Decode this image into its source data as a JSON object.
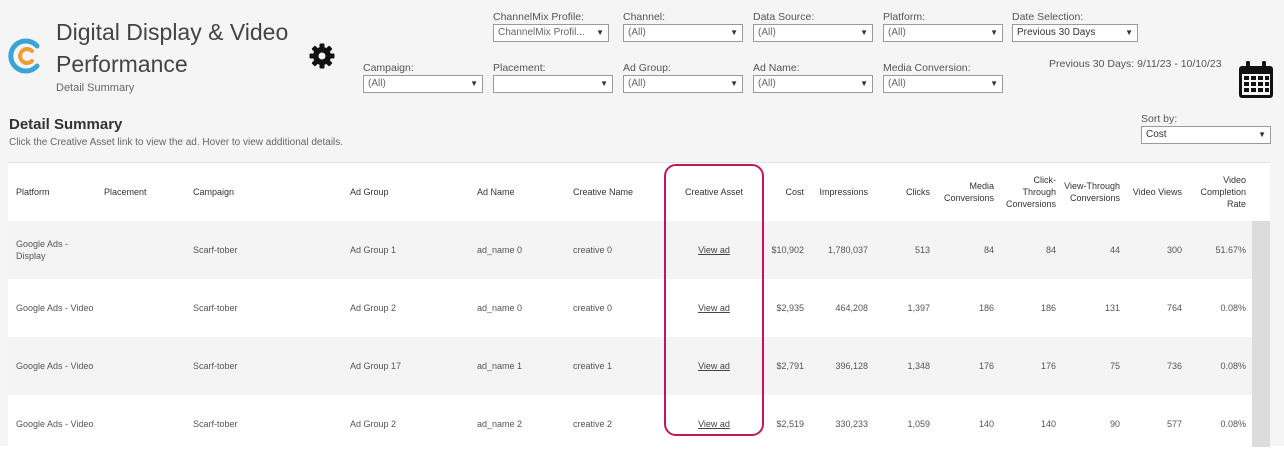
{
  "header": {
    "title": "Digital Display & Video Performance",
    "subtitle": "Detail Summary"
  },
  "filters": {
    "channelmix_profile": {
      "label": "ChannelMix Profile:",
      "value": "ChannelMix Profil..."
    },
    "channel": {
      "label": "Channel:",
      "value": "(All)"
    },
    "data_source": {
      "label": "Data Source:",
      "value": "(All)"
    },
    "platform": {
      "label": "Platform:",
      "value": "(All)"
    },
    "date_selection": {
      "label": "Date Selection:",
      "value": "Previous 30 Days"
    },
    "campaign": {
      "label": "Campaign:",
      "value": "(All)"
    },
    "placement": {
      "label": "Placement:",
      "value": ""
    },
    "ad_group": {
      "label": "Ad Group:",
      "value": "(All)"
    },
    "ad_name": {
      "label": "Ad Name:",
      "value": "(All)"
    },
    "media_conversion": {
      "label": "Media Conversion:",
      "value": "(All)"
    }
  },
  "date_range": "Previous 30 Days: 9/11/23 - 10/10/23",
  "detail": {
    "title": "Detail Summary",
    "subtitle": "Click the Creative Asset link to view the ad. Hover to view additional details.",
    "sort_by": {
      "label": "Sort by:",
      "value": "Cost"
    }
  },
  "table": {
    "headers": {
      "platform": "Platform",
      "placement": "Placement",
      "campaign": "Campaign",
      "ad_group": "Ad Group",
      "ad_name": "Ad Name",
      "creative_name": "Creative Name",
      "creative_asset": "Creative Asset",
      "cost": "Cost",
      "impressions": "Impressions",
      "clicks": "Clicks",
      "media_conversions": "Media Conversions",
      "click_through_conversions": "Click-Through Conversions",
      "view_through_conversions": "View-Through Conversions",
      "video_views": "Video Views",
      "video_completion_rate": "Video Completion Rate"
    },
    "rows": [
      {
        "platform": "Google Ads - Display",
        "placement": "",
        "campaign": "Scarf-tober",
        "ad_group": "Ad Group 1",
        "ad_name": "ad_name 0",
        "creative_name": "creative 0",
        "creative_asset": "View ad",
        "cost": "$10,902",
        "impressions": "1,780,037",
        "clicks": "513",
        "media_conversions": "84",
        "click_through_conversions": "84",
        "view_through_conversions": "44",
        "video_views": "300",
        "video_completion_rate": "51.67%"
      },
      {
        "platform": "Google Ads - Video",
        "placement": "",
        "campaign": "Scarf-tober",
        "ad_group": "Ad Group 2",
        "ad_name": "ad_name 0",
        "creative_name": "creative 0",
        "creative_asset": "View ad",
        "cost": "$2,935",
        "impressions": "464,208",
        "clicks": "1,397",
        "media_conversions": "186",
        "click_through_conversions": "186",
        "view_through_conversions": "131",
        "video_views": "764",
        "video_completion_rate": "0.08%"
      },
      {
        "platform": "Google Ads - Video",
        "placement": "",
        "campaign": "Scarf-tober",
        "ad_group": "Ad Group 17",
        "ad_name": "ad_name 1",
        "creative_name": "creative 1",
        "creative_asset": "View ad",
        "cost": "$2,791",
        "impressions": "396,128",
        "clicks": "1,348",
        "media_conversions": "176",
        "click_through_conversions": "176",
        "view_through_conversions": "75",
        "video_views": "736",
        "video_completion_rate": "0.08%"
      },
      {
        "platform": "Google Ads - Video",
        "placement": "",
        "campaign": "Scarf-tober",
        "ad_group": "Ad Group 2",
        "ad_name": "ad_name 2",
        "creative_name": "creative 2",
        "creative_asset": "View ad",
        "cost": "$2,519",
        "impressions": "330,233",
        "clicks": "1,059",
        "media_conversions": "140",
        "click_through_conversions": "140",
        "view_through_conversions": "90",
        "video_views": "577",
        "video_completion_rate": "0.08%"
      }
    ]
  },
  "colors": {
    "highlight": "#c2185b",
    "logo_blue": "#3aa3d8",
    "logo_orange": "#f39c32"
  },
  "icons": {
    "logo": "channelmix-logo-icon",
    "settings": "gear-icon",
    "calendar": "calendar-icon",
    "dropdown": "chevron-down-icon"
  }
}
